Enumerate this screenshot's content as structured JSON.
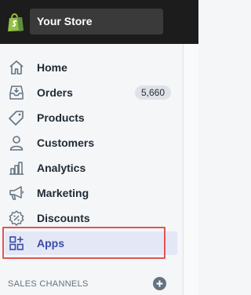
{
  "topbar": {
    "logo_icon": "shopify-bag-icon",
    "store_name": "Your Store"
  },
  "nav": [
    {
      "label": "Home",
      "icon": "home-icon",
      "active": false
    },
    {
      "label": "Orders",
      "icon": "orders-icon",
      "badge": "5,660",
      "active": false
    },
    {
      "label": "Products",
      "icon": "tag-icon",
      "active": false
    },
    {
      "label": "Customers",
      "icon": "person-icon",
      "active": false
    },
    {
      "label": "Analytics",
      "icon": "bar-chart-icon",
      "active": false
    },
    {
      "label": "Marketing",
      "icon": "megaphone-icon",
      "active": false
    },
    {
      "label": "Discounts",
      "icon": "discount-icon",
      "active": false
    },
    {
      "label": "Apps",
      "icon": "apps-icon",
      "active": true
    }
  ],
  "sales_channels": {
    "title": "SALES CHANNELS",
    "add_icon": "plus-circle-icon"
  },
  "colors": {
    "topbar": "#1c1c1c",
    "sidebar": "#f4f6f8",
    "active_bg": "#e4e7f6",
    "active_text": "#3a4ba8",
    "highlight": "#e25454",
    "icon": "#637381"
  }
}
